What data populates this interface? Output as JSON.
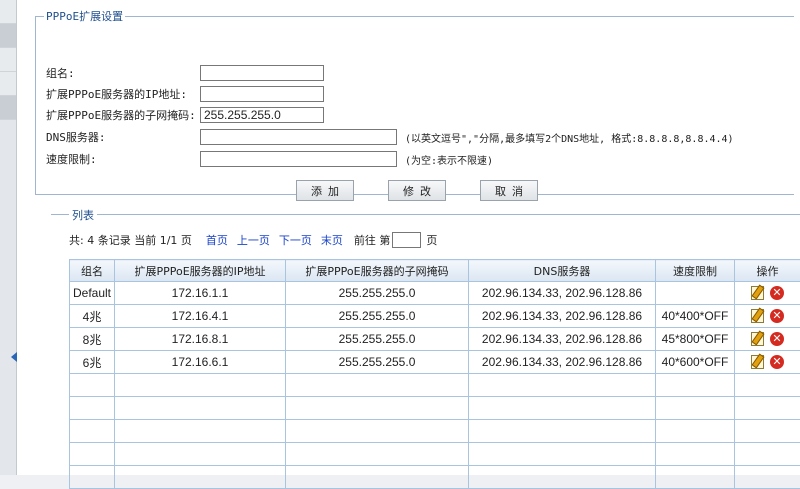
{
  "form": {
    "legend": "PPPoE扩展设置",
    "fields": [
      {
        "label": "组名:",
        "value": ""
      },
      {
        "label": "扩展PPPoE服务器的IP地址:",
        "value": ""
      },
      {
        "label": "扩展PPPoE服务器的子网掩码:",
        "value": "255.255.255.0"
      },
      {
        "label": "DNS服务器:",
        "value": "",
        "hint": "(以英文逗号\",\"分隔,最多填写2个DNS地址, 格式:8.8.8.8,8.8.4.4)"
      },
      {
        "label": "速度限制:",
        "value": "",
        "hint": "(为空:表示不限速)"
      }
    ],
    "buttons": {
      "add": "添加",
      "modify": "修改",
      "cancel": "取消"
    }
  },
  "list": {
    "title": "列表",
    "pager": {
      "info": "共: 4 条记录 当前 1/1 页",
      "first": "首页",
      "prev": "上一页",
      "next": "下一页",
      "last": "末页",
      "goto_prefix": "前往 第",
      "goto_suffix": "页",
      "page_value": ""
    },
    "columns": [
      "组名",
      "扩展PPPoE服务器的IP地址",
      "扩展PPPoE服务器的子网掩码",
      "DNS服务器",
      "速度限制",
      "操作"
    ],
    "rows": [
      {
        "name": "Default",
        "ip": "172.16.1.1",
        "mask": "255.255.255.0",
        "dns": "202.96.134.33, 202.96.128.86",
        "speed": ""
      },
      {
        "name": "4兆",
        "ip": "172.16.4.1",
        "mask": "255.255.255.0",
        "dns": "202.96.134.33, 202.96.128.86",
        "speed": "40*400*OFF"
      },
      {
        "name": "8兆",
        "ip": "172.16.8.1",
        "mask": "255.255.255.0",
        "dns": "202.96.134.33, 202.96.128.86",
        "speed": "45*800*OFF"
      },
      {
        "name": "6兆",
        "ip": "172.16.6.1",
        "mask": "255.255.255.0",
        "dns": "202.96.134.33, 202.96.128.86",
        "speed": "40*600*OFF"
      }
    ],
    "empty_rows": 5
  },
  "icons": {
    "edit": "edit-icon",
    "delete": "delete-icon",
    "collapse": "chevron-left-icon"
  }
}
